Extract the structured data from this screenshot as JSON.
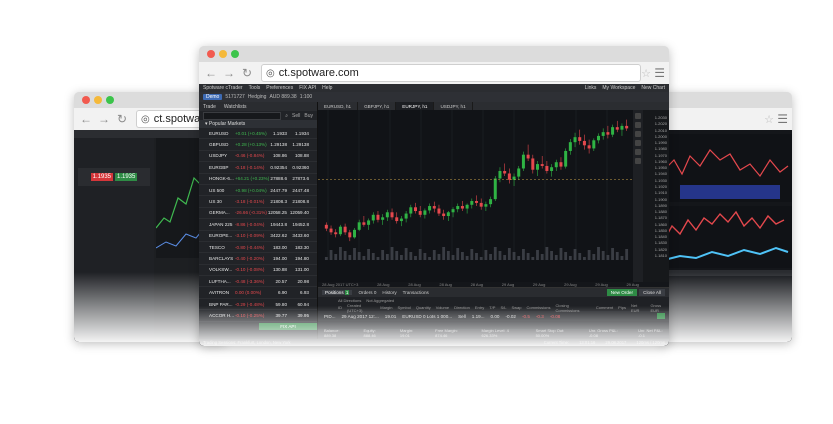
{
  "browser_main": {
    "url": "ct.spotware.com"
  },
  "browser_left": {
    "url": "ct.spotware"
  },
  "app": {
    "menu": [
      "Spotware cTrader",
      "Tools",
      "Preferences",
      "FIX API",
      "Help"
    ],
    "toolbar": {
      "mode": "Demo",
      "account": "5171727",
      "type": "Hedging",
      "balance": "AUD 889.38",
      "leverage": "1:100"
    },
    "chart_tabs": [
      "EURUSD, h1",
      "GBPJPY, h1",
      "EURJPY, h1",
      "USDJPY, h1"
    ],
    "right_menu": [
      "Links",
      "My Workspace",
      "New Chart"
    ]
  },
  "watchlist": {
    "tabs": [
      "Trade",
      "Watchlists"
    ],
    "sell": "Sell",
    "buy": "Buy",
    "group": "Popular Markets",
    "rows": [
      {
        "sym": "EURUSD",
        "chg": "+0.01 (+0.45%)",
        "bid": "1.1933",
        "ask": "1.1934",
        "up": true
      },
      {
        "sym": "GBPUSD",
        "chg": "+0.28 (+0.13%)",
        "bid": "1.29138",
        "ask": "1.29138",
        "up": true
      },
      {
        "sym": "USDJPY",
        "chg": "-0.46 (-0.84%)",
        "bid": "108.86",
        "ask": "108.88",
        "up": false
      },
      {
        "sym": "EURGBP",
        "chg": "-0.18 (-0.14%)",
        "bid": "0.92354",
        "ask": "0.92360",
        "up": false
      },
      {
        "sym": "HONGK-6...",
        "chg": "+64.21 (+0.23%)",
        "bid": "27888.6",
        "ask": "27873.6",
        "up": true
      },
      {
        "sym": "US 500",
        "chg": "+0.98 (+0.04%)",
        "bid": "2447.79",
        "ask": "2447.48",
        "up": true
      },
      {
        "sym": "US 30",
        "chg": "-3.18 (-0.01%)",
        "bid": "21808.3",
        "ask": "21808.8",
        "up": false
      },
      {
        "sym": "GERMA...",
        "chg": "-26.66 (-0.31%)",
        "bid": "12058.25",
        "ask": "12059.40",
        "up": false
      },
      {
        "sym": "JAPAN 225",
        "chg": "-8.86 (-0.04%)",
        "bid": "19443.8",
        "ask": "19452.8",
        "up": false
      },
      {
        "sym": "EUROPE...",
        "chg": "-3.10 (-0.09%)",
        "bid": "3422.62",
        "ask": "3433.60",
        "up": false
      },
      {
        "sym": "TESCO",
        "chg": "-0.80 (-0.44%)",
        "bid": "183.00",
        "ask": "183.30",
        "up": false
      },
      {
        "sym": "BARCLAYS",
        "chg": "-0.40 (-0.20%)",
        "bid": "194.00",
        "ask": "194.80",
        "up": false
      },
      {
        "sym": "VOLKSW...",
        "chg": "-0.10 (-0.08%)",
        "bid": "130.88",
        "ask": "131.00",
        "up": false
      },
      {
        "sym": "LUFTHA...",
        "chg": "-0.48 (-3.36%)",
        "bid": "20.57",
        "ask": "20.98",
        "up": false
      },
      {
        "sym": "AVITRON",
        "chg": "0.00 (0.00%)",
        "bid": "6.90",
        "ask": "6.93",
        "up": false
      },
      {
        "sym": "BNP PAR...",
        "chg": "-0.29 (-0.48%)",
        "bid": "59.80",
        "ask": "60.94",
        "up": false
      },
      {
        "sym": "ACCOR H...",
        "chg": "-0.10 (-0.25%)",
        "bid": "39.77",
        "ask": "39.95",
        "up": false
      }
    ],
    "fix_api": "FIX API",
    "status": "Trading Sessions: Frankfurt, London, New York"
  },
  "positions": {
    "tabs": [
      "Positions",
      "Orders",
      "History",
      "Transactions"
    ],
    "positions_count": "1",
    "orders_count": "0",
    "filter_dir": "All Directions",
    "filter_agg": "Not Aggregated",
    "new_order": "New Order",
    "close_all": "Close All",
    "feedback": "Feedback",
    "cols": [
      "ID",
      "Created (UTC+3)",
      "Margin",
      "Symbol",
      "Quantity",
      "Volume",
      "Direction",
      "Entry",
      "T/P",
      "S/L",
      "Swap",
      "Commissions",
      "Closing Commissions",
      "Comment",
      "Pips",
      "Net EUR",
      "Gross EUR"
    ],
    "row": {
      "id": "PID...",
      "created": "29 Aug 2017 12:...",
      "margin": "19.01",
      "symbol": "EURUSD 0 Lots 1 000...",
      "dir": "Sell",
      "entry": "1.19...",
      "swap": "0.00",
      "comm": "-0.02",
      "pips": "-0.5",
      "net": "-0.3",
      "gross": "-0.08"
    },
    "summary": [
      "Balance: 889.38",
      "Equity: 888.46",
      "Margin: 19.01",
      "Free Margin: 874.46",
      "Margin Level: 4 626.33%",
      "Smart Stop Out: 50.00%",
      "Unr. Gross P&L: -0.08",
      "Unr. Net P&L: -0.1"
    ]
  },
  "status": {
    "server_time": "Current Time:",
    "time": "13:01:16",
    "date": "29.08.2017",
    "latency": "120ms / 120ms"
  },
  "chart_data": {
    "type": "candlestick",
    "symbol": "EURUSD, h1",
    "price_ticks": [
      "1.2030",
      "1.2020",
      "1.2010",
      "1.2000",
      "1.1990",
      "1.1980",
      "1.1970",
      "1.1960",
      "1.1950",
      "1.1940",
      "1.1930",
      "1.1920",
      "1.1910",
      "1.1900",
      "1.1890",
      "1.1880",
      "1.1870",
      "1.1860",
      "1.1850",
      "1.1840",
      "1.1830",
      "1.1820",
      "1.1810"
    ],
    "time_ticks": [
      "28 Aug 2017 UTC+3",
      "28 Aug",
      "28 Aug",
      "28 Aug",
      "28 Aug",
      "29 Aug",
      "29 Aug",
      "29 Aug",
      "29 Aug",
      "29 Aug"
    ],
    "last_price": "1.1930",
    "candles": [
      [
        1.1858,
        1.1862,
        1.1848,
        1.1852
      ],
      [
        1.1852,
        1.1857,
        1.1842,
        1.1846
      ],
      [
        1.1846,
        1.1851,
        1.1838,
        1.1843
      ],
      [
        1.1843,
        1.1858,
        1.184,
        1.1855
      ],
      [
        1.1855,
        1.186,
        1.1842,
        1.1846
      ],
      [
        1.1846,
        1.185,
        1.1832,
        1.1838
      ],
      [
        1.1838,
        1.1853,
        1.1836,
        1.185
      ],
      [
        1.185,
        1.1866,
        1.1848,
        1.1862
      ],
      [
        1.1862,
        1.1872,
        1.1855,
        1.1858
      ],
      [
        1.1858,
        1.1868,
        1.185,
        1.1865
      ],
      [
        1.1865,
        1.1878,
        1.186,
        1.1874
      ],
      [
        1.1874,
        1.188,
        1.1862,
        1.1866
      ],
      [
        1.1866,
        1.1875,
        1.1858,
        1.187
      ],
      [
        1.187,
        1.1882,
        1.1864,
        1.1878
      ],
      [
        1.1878,
        1.1884,
        1.1866,
        1.187
      ],
      [
        1.187,
        1.1878,
        1.186,
        1.1864
      ],
      [
        1.1864,
        1.1872,
        1.1856,
        1.1868
      ],
      [
        1.1868,
        1.188,
        1.1862,
        1.1876
      ],
      [
        1.1876,
        1.189,
        1.187,
        1.1886
      ],
      [
        1.1886,
        1.1893,
        1.1876,
        1.188
      ],
      [
        1.188,
        1.1888,
        1.187,
        1.1874
      ],
      [
        1.1874,
        1.1884,
        1.1868,
        1.1881
      ],
      [
        1.1881,
        1.1892,
        1.1876,
        1.1888
      ],
      [
        1.1888,
        1.1895,
        1.1878,
        1.1884
      ],
      [
        1.1884,
        1.189,
        1.1872,
        1.1876
      ],
      [
        1.1876,
        1.1882,
        1.1866,
        1.1872
      ],
      [
        1.1872,
        1.188,
        1.1864,
        1.1878
      ],
      [
        1.1878,
        1.1886,
        1.187,
        1.1883
      ],
      [
        1.1883,
        1.1892,
        1.1878,
        1.1888
      ],
      [
        1.1888,
        1.1896,
        1.188,
        1.1884
      ],
      [
        1.1884,
        1.1892,
        1.1876,
        1.189
      ],
      [
        1.189,
        1.19,
        1.1884,
        1.1896
      ],
      [
        1.1896,
        1.1905,
        1.1888,
        1.1893
      ],
      [
        1.1893,
        1.19,
        1.1882,
        1.1887
      ],
      [
        1.1887,
        1.1895,
        1.188,
        1.1891
      ],
      [
        1.1891,
        1.1903,
        1.1886,
        1.1899
      ],
      [
        1.1899,
        1.1936,
        1.1896,
        1.1932
      ],
      [
        1.1932,
        1.195,
        1.1926,
        1.1944
      ],
      [
        1.1944,
        1.1956,
        1.1936,
        1.194
      ],
      [
        1.194,
        1.1948,
        1.1924,
        1.193
      ],
      [
        1.193,
        1.194,
        1.192,
        1.1935
      ],
      [
        1.1935,
        1.1952,
        1.193,
        1.1948
      ],
      [
        1.1948,
        1.1975,
        1.1944,
        1.197
      ],
      [
        1.197,
        1.1986,
        1.196,
        1.1964
      ],
      [
        1.1964,
        1.197,
        1.194,
        1.1946
      ],
      [
        1.1946,
        1.196,
        1.1936,
        1.1955
      ],
      [
        1.1955,
        1.1968,
        1.1948,
        1.1952
      ],
      [
        1.1952,
        1.196,
        1.194,
        1.1944
      ],
      [
        1.1944,
        1.1955,
        1.1935,
        1.195
      ],
      [
        1.195,
        1.1962,
        1.1944,
        1.1958
      ],
      [
        1.1958,
        1.1966,
        1.1946,
        1.1951
      ],
      [
        1.1951,
        1.198,
        1.1948,
        1.1976
      ],
      [
        1.1976,
        1.1995,
        1.197,
        1.199
      ],
      [
        1.199,
        1.2005,
        1.1982,
        1.1998
      ],
      [
        1.1998,
        1.201,
        1.1986,
        1.1992
      ],
      [
        1.1992,
        1.2002,
        1.1978,
        1.1985
      ],
      [
        1.1985,
        1.1994,
        1.1972,
        1.198
      ],
      [
        1.198,
        1.1996,
        1.1976,
        1.1993
      ],
      [
        1.1993,
        1.2004,
        1.1988,
        1.2
      ],
      [
        1.2,
        1.2012,
        1.1994,
        1.2006
      ],
      [
        1.2006,
        1.2016,
        1.1996,
        1.2002
      ],
      [
        1.2002,
        1.2018,
        1.1998,
        1.2014
      ],
      [
        1.2014,
        1.2024,
        1.2006,
        1.201
      ],
      [
        1.201,
        1.202,
        1.2,
        1.2016
      ],
      [
        1.2016,
        1.2026,
        1.2008,
        1.2012
      ]
    ]
  }
}
